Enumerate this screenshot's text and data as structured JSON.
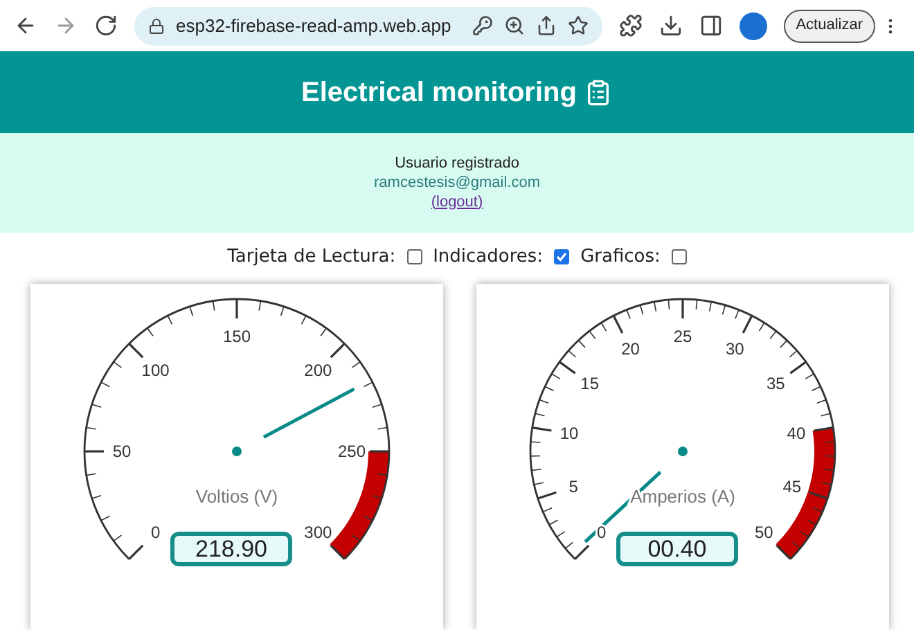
{
  "browser": {
    "url": "esp32-firebase-read-amp.web.app",
    "update_button": "Actualizar"
  },
  "header": {
    "title": "Electrical monitoring"
  },
  "user": {
    "heading": "Usuario registrado",
    "email": "ramcestesis@gmail.com",
    "logout": "(logout)"
  },
  "options": [
    {
      "label": "Tarjeta de Lectura:",
      "checked": false
    },
    {
      "label": "Indicadores:",
      "checked": true
    },
    {
      "label": "Graficos:",
      "checked": false
    }
  ],
  "gauges": [
    {
      "unit": "Voltios (V)",
      "value": "218.90",
      "scale": [
        {
          "label": "0",
          "alarm": false
        },
        {
          "label": "50",
          "alarm": false
        },
        {
          "label": "100",
          "alarm": false
        },
        {
          "label": "150",
          "alarm": false
        },
        {
          "label": "200",
          "alarm": false
        },
        {
          "label": "250",
          "alarm": true
        },
        {
          "label": "300"
        }
      ]
    },
    {
      "unit": "Amperios (A)",
      "value": "00.40",
      "scale": [
        {
          "label": "0",
          "alarm": false
        },
        {
          "label": "5",
          "alarm": false
        },
        {
          "label": "10",
          "alarm": false
        },
        {
          "label": "15",
          "alarm": false
        },
        {
          "label": "20",
          "alarm": false
        },
        {
          "label": "25",
          "alarm": false
        },
        {
          "label": "30",
          "alarm": false
        },
        {
          "label": "35",
          "alarm": false
        },
        {
          "label": "40",
          "alarm": true
        },
        {
          "label": "45",
          "alarm": true
        },
        {
          "label": "50"
        }
      ]
    }
  ]
}
